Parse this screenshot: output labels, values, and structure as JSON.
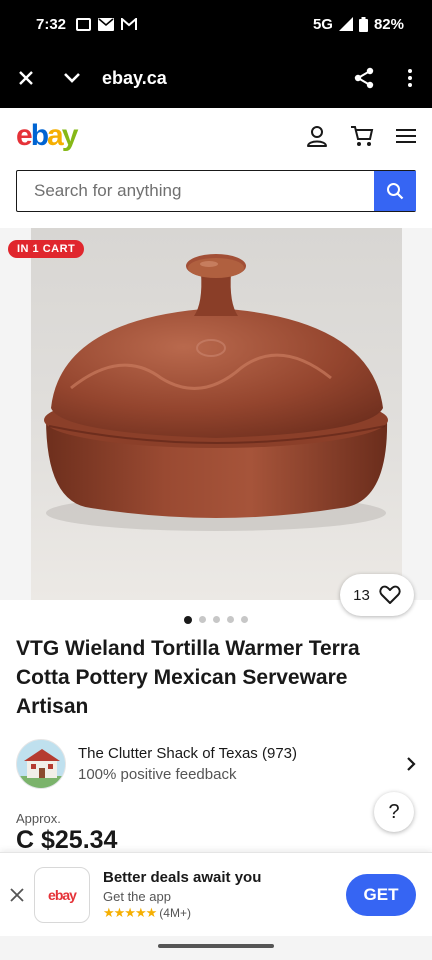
{
  "status_bar": {
    "time": "7:32",
    "network": "5G",
    "battery": "82%"
  },
  "browser": {
    "url": "ebay.ca"
  },
  "site": {
    "logo": [
      "e",
      "b",
      "a",
      "y"
    ]
  },
  "search": {
    "placeholder": "Search for anything"
  },
  "listing": {
    "badge": "IN 1 CART",
    "watch_count": "13",
    "image_count": 5,
    "active_image_index": 0,
    "title": "VTG Wieland Tortilla Warmer Terra Cotta Pottery Mexican Serveware Artisan",
    "price_prefix": "Approx.",
    "price": "C $25.34"
  },
  "seller": {
    "name": "The Clutter Shack of Texas (973)",
    "feedback": "100% positive feedback"
  },
  "help_label": "?",
  "app_banner": {
    "logo_text": "ebay",
    "headline": "Better deals await you",
    "subtext": "Get the app",
    "stars": "★★★★★",
    "rating_count": "(4M+)",
    "get_label": "GET"
  },
  "colors": {
    "ebay_red": "#e53238",
    "ebay_blue": "#0064d2",
    "ebay_yellow": "#f5af02",
    "ebay_green": "#86b817",
    "primary_button": "#3665f3",
    "badge_red": "#e0262d"
  }
}
